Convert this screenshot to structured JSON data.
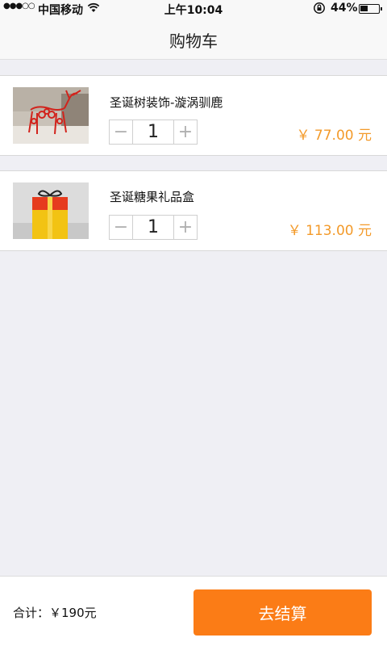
{
  "status_bar": {
    "signal_dots": "●●●○○",
    "carrier": "中国移动",
    "time": "上午10:04",
    "battery_percent": "44%",
    "battery_level": 0.44,
    "icons": [
      "wifi-icon",
      "rotation-lock-icon",
      "battery-icon"
    ]
  },
  "nav": {
    "title": "购物车"
  },
  "items": [
    {
      "name": "圣诞树装饰-漩涡驯鹿",
      "quantity": "1",
      "price": "￥ 77.00 元",
      "decrement_label": "−",
      "increment_label": "+"
    },
    {
      "name": "圣诞糖果礼品盒",
      "quantity": "1",
      "price": "￥ 113.00 元",
      "decrement_label": "−",
      "increment_label": "+"
    }
  ],
  "footer": {
    "total_label": "合计：￥190元",
    "checkout_label": "去结算"
  },
  "colors": {
    "accent": "#fb7c16",
    "price": "#f39a2a",
    "background": "#efeff4"
  }
}
